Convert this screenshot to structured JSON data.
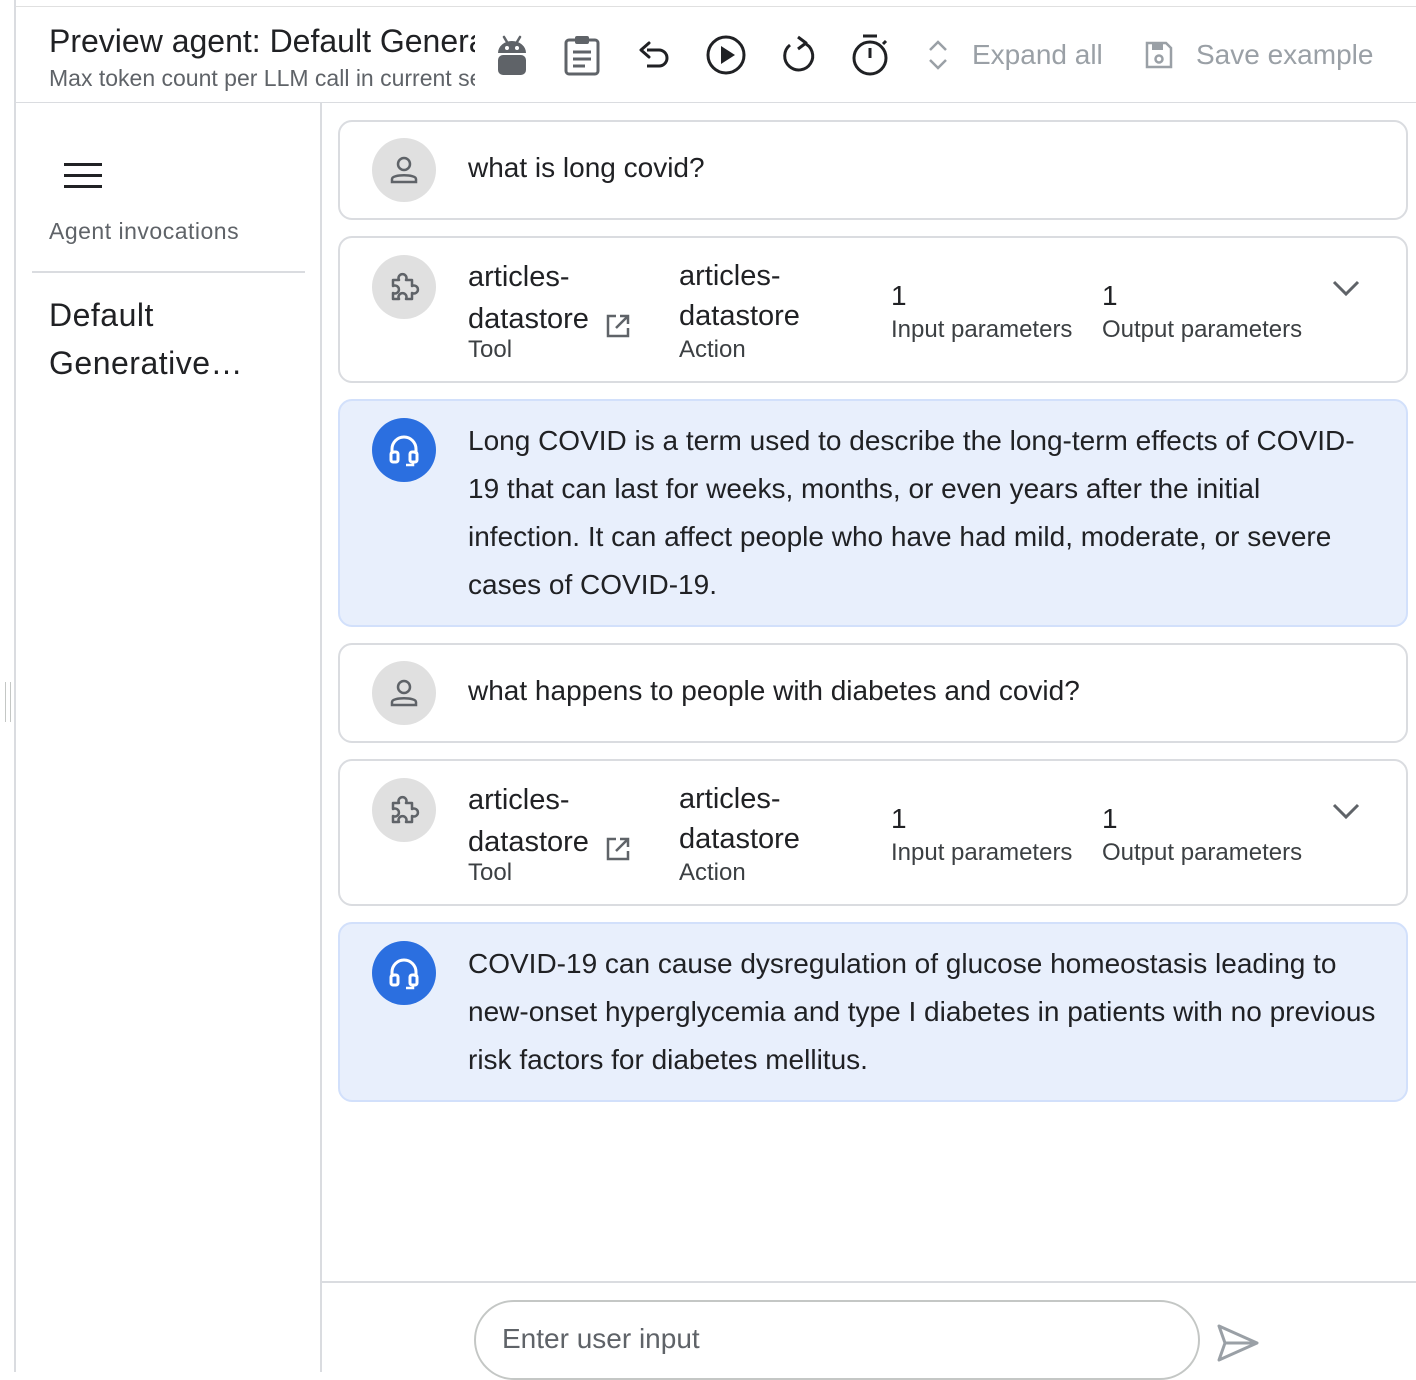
{
  "header": {
    "title": "Preview agent: Default Generative Agent",
    "subtitle": "Max token count per LLM call in current session"
  },
  "toolbar": {
    "expand_all_label": "Expand all",
    "save_example_label": "Save example",
    "icons": [
      "android-icon",
      "clipboard-icon",
      "undo-icon",
      "play-icon",
      "replay-icon",
      "timer-icon",
      "unfold-icon",
      "save-icon"
    ]
  },
  "sidebar": {
    "section_label": "Agent invocations",
    "items": [
      {
        "label": "Default Generative…"
      }
    ]
  },
  "conversation": [
    {
      "role": "user",
      "text": "what is long covid?"
    },
    {
      "role": "tool",
      "tool_name": "articles-datastore",
      "tool_type": "Tool",
      "action_name": "articles-datastore",
      "action_type": "Action",
      "input_count": "1",
      "input_label": "Input parameters",
      "output_count": "1",
      "output_label": "Output parameters"
    },
    {
      "role": "agent",
      "text": "Long COVID is a term used to describe the long-term effects of COVID-19 that can last for weeks, months, or even years after the initial infection. It can affect people who have had mild, moderate, or severe cases of COVID-19."
    },
    {
      "role": "user",
      "text": "what happens to people with diabetes and covid?"
    },
    {
      "role": "tool",
      "tool_name": "articles-datastore",
      "tool_type": "Tool",
      "action_name": "articles-datastore",
      "action_type": "Action",
      "input_count": "1",
      "input_label": "Input parameters",
      "output_count": "1",
      "output_label": "Output parameters"
    },
    {
      "role": "agent",
      "text": "COVID-19 can cause dysregulation of glucose homeostasis leading to new-onset hyperglycemia and type I diabetes in patients with no previous risk factors for diabetes mellitus."
    }
  ],
  "input": {
    "placeholder": "Enter user input",
    "value": ""
  },
  "colors": {
    "agent_bubble": "#e8effc",
    "agent_avatar": "#2b6fe0",
    "border": "#dadce0"
  }
}
